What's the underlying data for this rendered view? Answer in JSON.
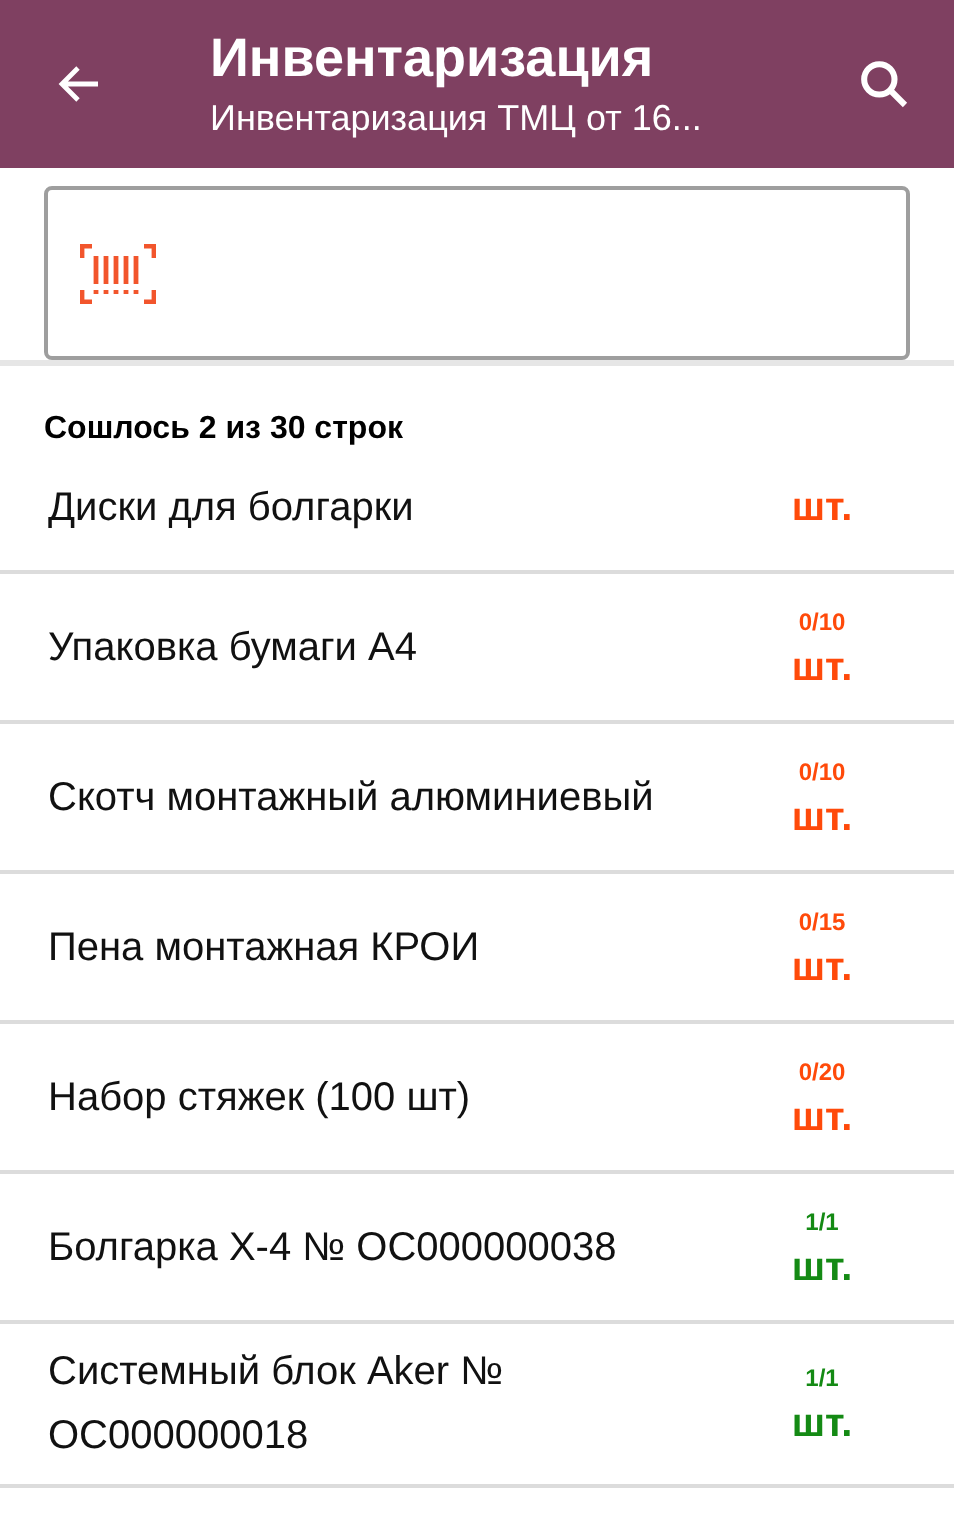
{
  "app_bar": {
    "title": "Инвентаризация",
    "subtitle": "Инвентаризация ТМЦ от 16..."
  },
  "summary": "Сошлось 2 из 30 строк",
  "rows": [
    {
      "name": "Диски для болгарки",
      "unit": "шт.",
      "matched": false
    },
    {
      "name": "Упаковка бумаги А4",
      "count": "0/10",
      "unit": "шт.",
      "matched": false
    },
    {
      "name": "Скотч монтажный алюминиевый",
      "count": "0/10",
      "unit": "шт.",
      "matched": false
    },
    {
      "name": "Пена монтажная КРОИ",
      "count": "0/15",
      "unit": "шт.",
      "matched": false
    },
    {
      "name": "Набор стяжек (100 шт)",
      "count": "0/20",
      "unit": "шт.",
      "matched": false
    },
    {
      "name": "Болгарка Х-4 № ОС000000038",
      "count": "1/1",
      "unit": "шт.",
      "matched": true
    },
    {
      "name": "Системный блок Aker № ОС000000018",
      "count": "1/1",
      "unit": "шт.",
      "matched": true
    }
  ]
}
